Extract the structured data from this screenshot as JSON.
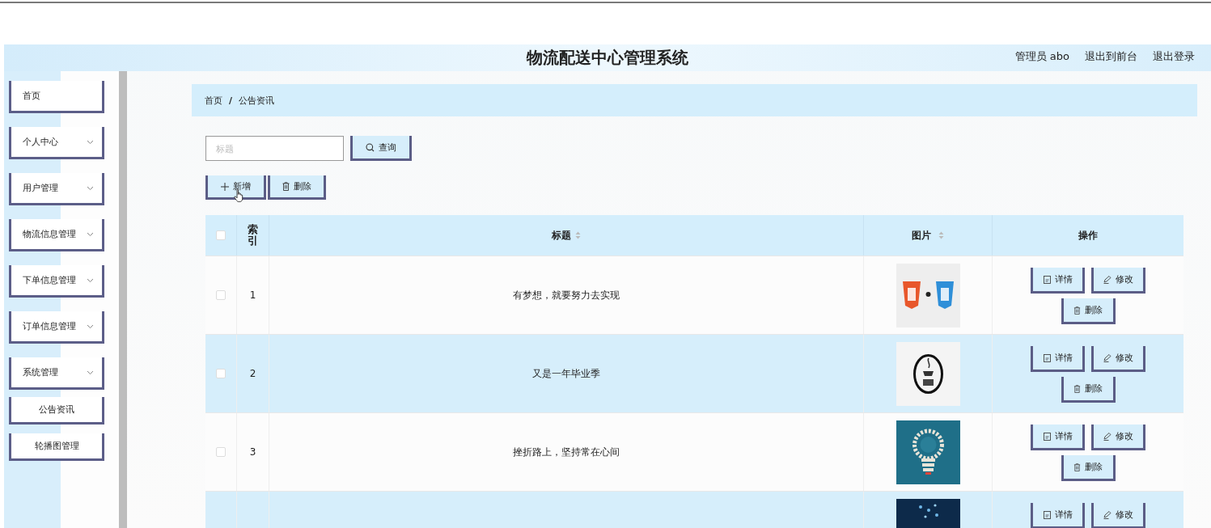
{
  "header": {
    "title": "物流配送中心管理系统",
    "user_label": "管理员 abo",
    "links": [
      "退出到前台",
      "退出登录"
    ]
  },
  "sidebar": {
    "items": [
      {
        "label": "首页",
        "kind": "link"
      },
      {
        "label": "个人中心",
        "kind": "submenu"
      },
      {
        "label": "用户管理",
        "kind": "submenu"
      },
      {
        "label": "物流信息管理",
        "kind": "submenu"
      },
      {
        "label": "下单信息管理",
        "kind": "submenu"
      },
      {
        "label": "订单信息管理",
        "kind": "submenu"
      },
      {
        "label": "系统管理",
        "kind": "submenu",
        "children": [
          {
            "label": "公告资讯"
          },
          {
            "label": "轮播图管理"
          }
        ]
      }
    ]
  },
  "breadcrumb": {
    "items": [
      "首页",
      "公告资讯"
    ],
    "separator": "/"
  },
  "search": {
    "placeholder": "标题",
    "button": "查询"
  },
  "toolbar": [
    {
      "label": "新增",
      "kind": "add"
    },
    {
      "label": "删除",
      "kind": "delete"
    }
  ],
  "table": {
    "select_all_checked": false,
    "columns": [
      {
        "label": "索引",
        "kind": "plain"
      },
      {
        "label": "标题",
        "kind": "sortable"
      },
      {
        "label": "图片",
        "kind": "sortable"
      },
      {
        "label": "操作",
        "kind": "plain"
      }
    ],
    "rows": [
      {
        "checked": false,
        "index": "1",
        "title": "有梦想，就要努力去实现",
        "image": {
          "kind": "picture"
        },
        "actions": [
          {
            "label": "详情",
            "kind": "detail"
          },
          {
            "label": "修改",
            "kind": "edit"
          },
          {
            "label": "删除",
            "kind": "delete"
          }
        ]
      },
      {
        "checked": false,
        "index": "2",
        "title": "又是一年毕业季",
        "image": {
          "kind": "picture"
        },
        "actions": [
          {
            "label": "详情",
            "kind": "detail"
          },
          {
            "label": "修改",
            "kind": "edit"
          },
          {
            "label": "删除",
            "kind": "delete"
          }
        ]
      },
      {
        "checked": false,
        "index": "3",
        "title": "挫折路上，坚持常在心间",
        "image": {
          "kind": "picture"
        },
        "actions": [
          {
            "label": "详情",
            "kind": "detail"
          },
          {
            "label": "修改",
            "kind": "edit"
          },
          {
            "label": "删除",
            "kind": "delete"
          }
        ]
      },
      {
        "image": {
          "kind": "picture"
        },
        "actions": [
          {
            "label": "详情",
            "kind": "detail"
          },
          {
            "label": "修改",
            "kind": "edit"
          }
        ]
      }
    ]
  }
}
